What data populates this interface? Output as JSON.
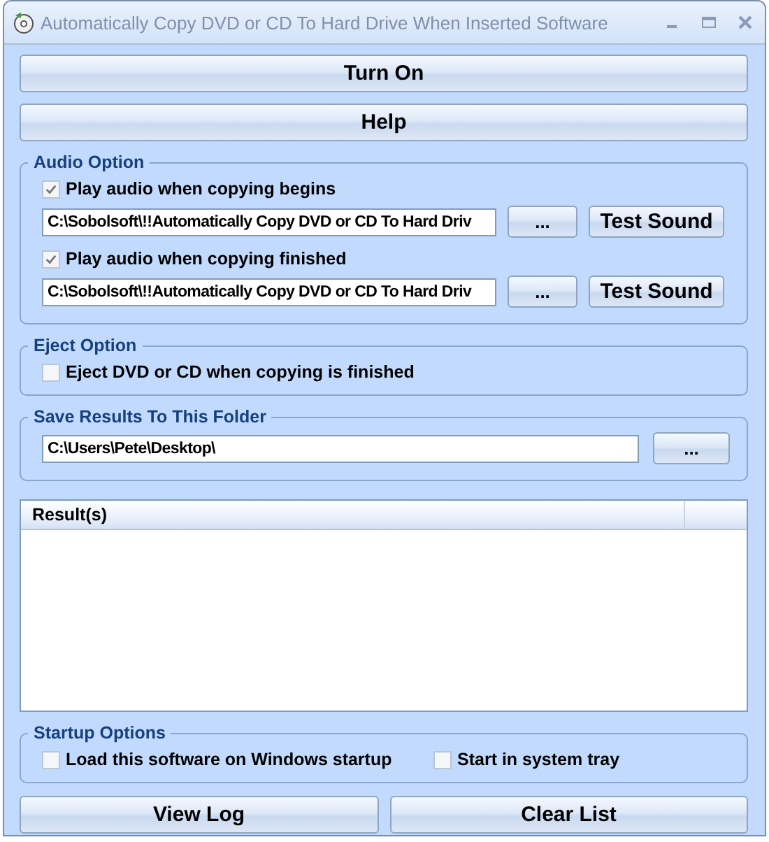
{
  "window": {
    "title": "Automatically Copy DVD or CD To Hard Drive When Inserted Software"
  },
  "top_buttons": [
    "Turn On",
    "Help"
  ],
  "audio_option": {
    "title": "Audio Option",
    "items": [
      {
        "label": "Play audio when copying begins",
        "checked": true,
        "path": "C:\\Sobolsoft\\!!Automatically Copy DVD or CD To Hard Driv",
        "browse": "...",
        "test": "Test Sound"
      },
      {
        "label": "Play audio when copying finished",
        "checked": true,
        "path": "C:\\Sobolsoft\\!!Automatically Copy DVD or CD To Hard Driv",
        "browse": "...",
        "test": "Test Sound"
      }
    ]
  },
  "eject_option": {
    "title": "Eject Option",
    "checkbox": {
      "label": "Eject DVD or CD when copying is finished",
      "checked": false
    }
  },
  "save_folder": {
    "title": "Save Results To This Folder",
    "path": "C:\\Users\\Pete\\Desktop\\",
    "browse": "..."
  },
  "results": {
    "columns": [
      "Result(s)"
    ]
  },
  "startup_options": {
    "title": "Startup Options",
    "checkboxes": [
      {
        "label": "Load this software on Windows startup",
        "checked": false
      },
      {
        "label": "Start in system tray",
        "checked": false
      }
    ]
  },
  "bottom_buttons": [
    "View Log",
    "Clear List"
  ]
}
